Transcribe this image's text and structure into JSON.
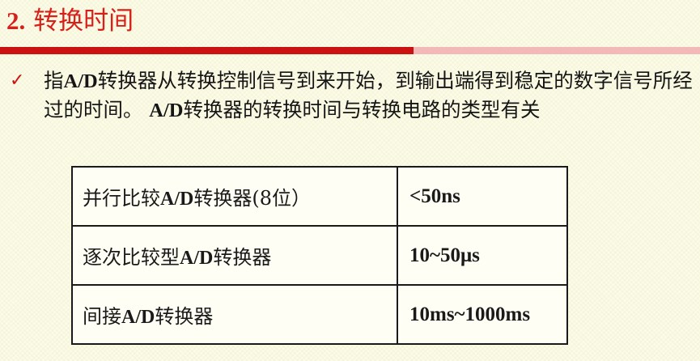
{
  "title": {
    "number": "2.",
    "text": "转换时间"
  },
  "bullet": {
    "segments": [
      {
        "text": "指",
        "bold": false
      },
      {
        "text": "A/D",
        "bold": true
      },
      {
        "text": "转换器从转换控制信号到来开始，到输出端得到稳定的数字信号所经过的时间。 ",
        "bold": false
      },
      {
        "text": "A/D",
        "bold": true
      },
      {
        "text": "转换器的转换时间与转换电路的类型有关",
        "bold": false
      }
    ]
  },
  "table": {
    "rows": [
      {
        "pre": "并行比较",
        "ad": "A/D",
        "post": "转换器",
        "suffix": "(8位）",
        "time": "<50ns"
      },
      {
        "pre": "逐次比较型",
        "ad": "A/D",
        "post": "转换器",
        "suffix": "",
        "time": "10~50μs"
      },
      {
        "pre": "间接",
        "ad": "A/D",
        "post": "转换器",
        "suffix": "",
        "time": "10ms~1000ms"
      }
    ]
  },
  "colors": {
    "title": "#d8201a",
    "rule_dark": "#cc1111",
    "rule_light": "#f3b8b8",
    "checkmark": "#cc1111"
  },
  "icons": {
    "bullet": "checkmark-icon"
  }
}
